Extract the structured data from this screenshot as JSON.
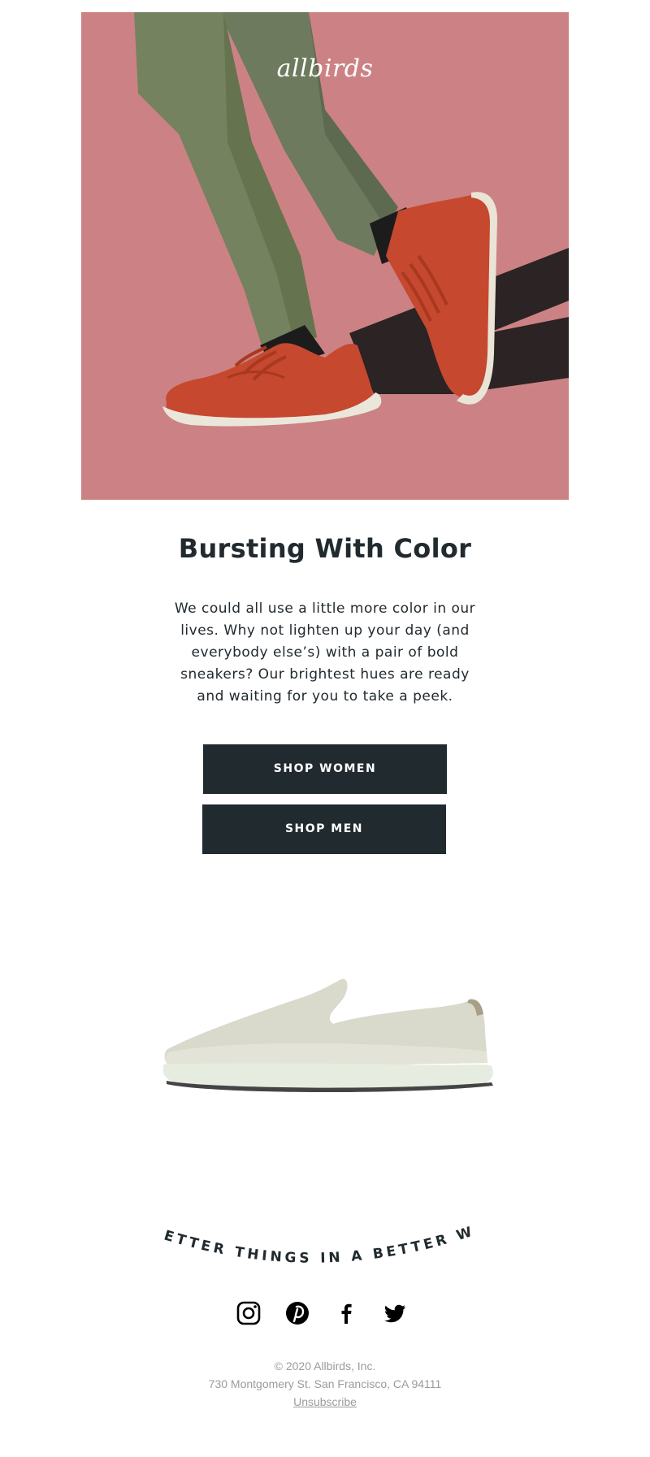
{
  "hero": {
    "brand": "allbirds",
    "background_color": "#cc8284",
    "image_subject": "legs in green pants wearing red knit sneakers"
  },
  "headline": "Bursting With Color",
  "body_text": "We could all use a little more color in our lives. Why not lighten up your day (and everybody else’s) with a pair of bold sneakers? Our brightest hues are ready and waiting for you to take a peek.",
  "buttons": {
    "shop_women": "SHOP WOMEN",
    "shop_men": "SHOP MEN",
    "color": "#212a2f"
  },
  "product": {
    "image_subject": "light wool slip-on shoe"
  },
  "tagline": "BETTER THINGS IN A BETTER WAY",
  "social": {
    "icons": [
      "instagram-icon",
      "pinterest-icon",
      "facebook-icon",
      "twitter-icon"
    ]
  },
  "footer": {
    "copyright": "© 2020 Allbirds, Inc.",
    "address": "730 Montgomery St. San Francisco, CA 94111",
    "unsubscribe": "Unsubscribe"
  }
}
